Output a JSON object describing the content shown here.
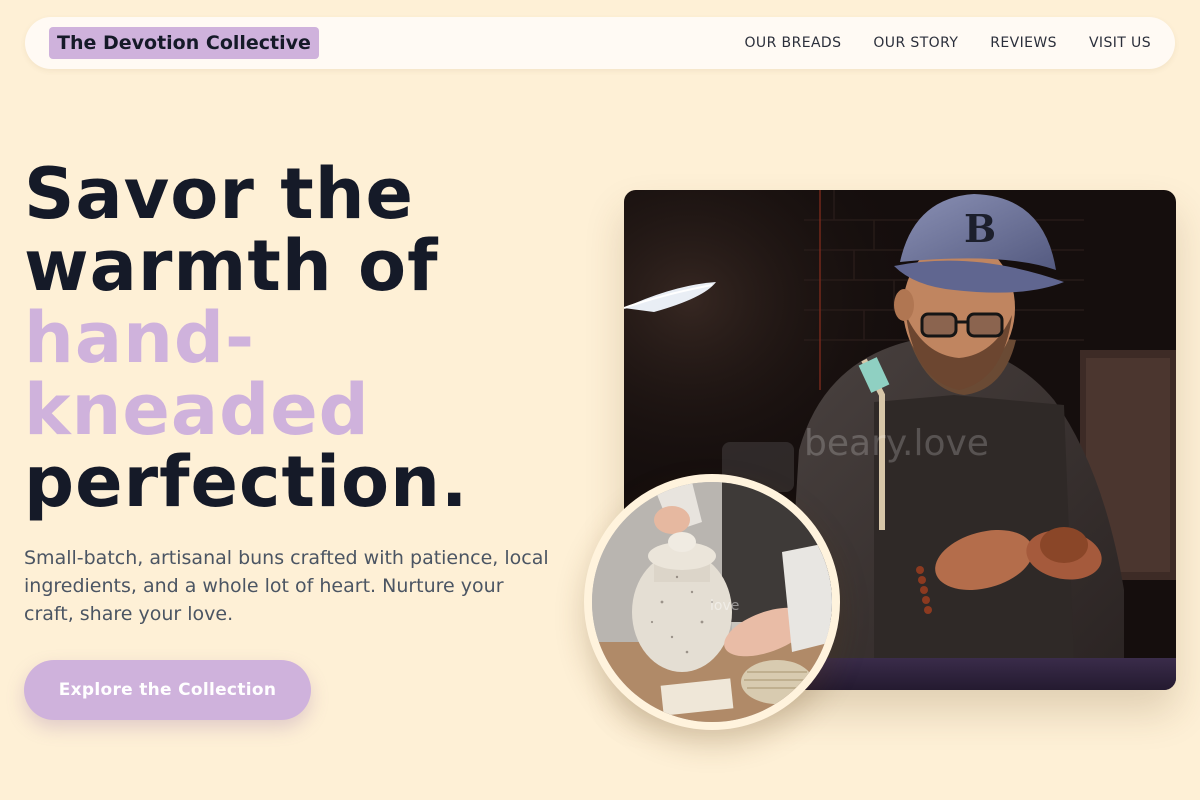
{
  "brand": {
    "name": "The Devotion Collective"
  },
  "nav": {
    "items": [
      {
        "label": "OUR BREADS"
      },
      {
        "label": "OUR STORY"
      },
      {
        "label": "REVIEWS"
      },
      {
        "label": "VISIT US"
      }
    ]
  },
  "hero": {
    "heading_line1": "Savor the",
    "heading_line2": "warmth of",
    "heading_accent_line1": "hand-",
    "heading_accent_line2": "kneaded",
    "heading_line3": "perfection.",
    "subtitle": "Small-batch, artisanal buns crafted with patience, local ingredients, and a whole lot of heart. Nurture your craft, share your love.",
    "cta_label": "Explore the Collection",
    "main_photo_watermark": "beary.love",
    "detail_photo_watermark": "love"
  },
  "colors": {
    "background": "#fef0d6",
    "navbar_bg": "#fffaf4",
    "accent_lavender": "#cfb2dc",
    "heading_text": "#151a28",
    "body_text": "#4b5563",
    "button_text": "#ffffff",
    "photo_ring": "#fff3dd"
  },
  "icons": {
    "main_photo": "artisan-photo",
    "detail_photo": "ceramic-jar-photo"
  }
}
